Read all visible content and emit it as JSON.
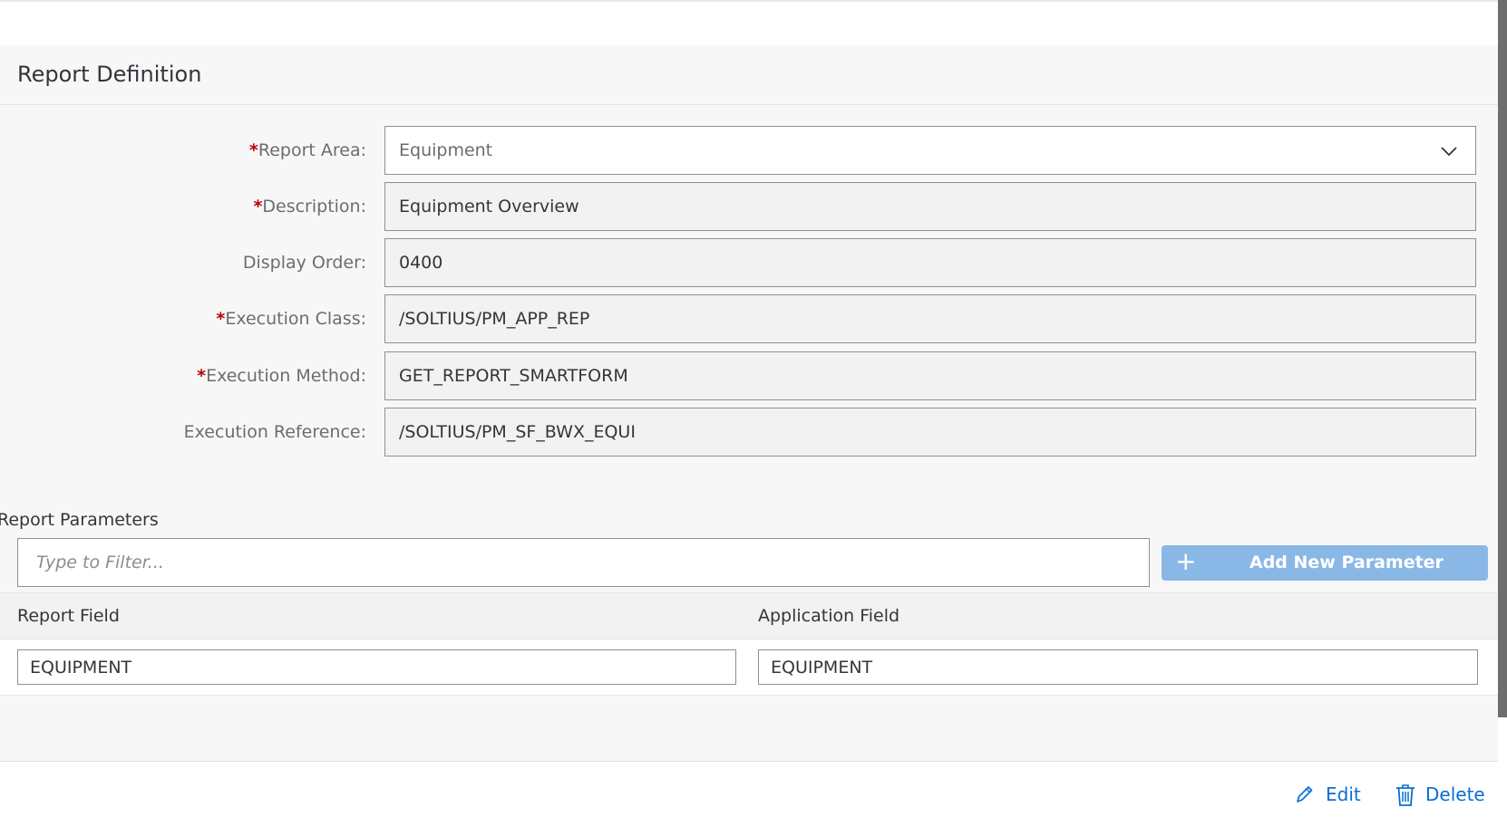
{
  "page": {
    "title": "Report Definition"
  },
  "form": {
    "report_area": {
      "label": "Report Area:",
      "required": "*",
      "value": "Equipment"
    },
    "description": {
      "label": "Description:",
      "required": "*",
      "value": "Equipment Overview"
    },
    "display_order": {
      "label": "Display Order:",
      "value": "0400"
    },
    "execution_class": {
      "label": "Execution Class:",
      "required": "*",
      "value": "/SOLTIUS/PM_APP_REP"
    },
    "execution_method": {
      "label": "Execution Method:",
      "required": "*",
      "value": "GET_REPORT_SMARTFORM"
    },
    "execution_reference": {
      "label": "Execution Reference:",
      "value": "/SOLTIUS/PM_SF_BWX_EQUI"
    }
  },
  "parameters": {
    "section_label": "Report Parameters",
    "filter_placeholder": "Type to Filter...",
    "add_button": {
      "icon": "plus-icon",
      "label": "Add New Parameter"
    },
    "columns": [
      "Report Field",
      "Application Field"
    ],
    "rows": [
      {
        "report_field": "EQUIPMENT",
        "application_field": "EQUIPMENT"
      }
    ]
  },
  "footer": {
    "edit": {
      "icon": "pencil-icon",
      "label": "Edit"
    },
    "delete": {
      "icon": "trash-icon",
      "label": "Delete"
    }
  },
  "colors": {
    "accent": "#0a6ed1",
    "required": "#bb0000",
    "button_disabled": "#8ab8e6",
    "background": "#f7f7f7"
  }
}
